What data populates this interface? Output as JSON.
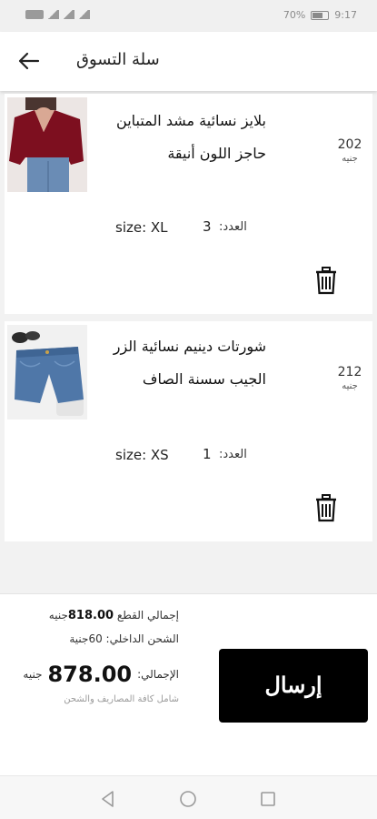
{
  "status_bar": {
    "battery": "70%",
    "battery_level": 0.7,
    "time": "9:17"
  },
  "header": {
    "title": "سلة التسوق"
  },
  "cart_items": [
    {
      "name": "بلايز نسائية مشد المتباين حاجز اللون أنيقة",
      "price": "202",
      "currency": "جنيه",
      "size": "size: XL",
      "qty_label": "العدد:",
      "qty": "3"
    },
    {
      "name": "شورتات دينيم نسائية الزر الجيب سسنة الصاف",
      "price": "212",
      "currency": "جنيه",
      "size": "size: XS",
      "qty_label": "العدد:",
      "qty": "1"
    }
  ],
  "summary": {
    "items_total_label": "إجمالي القطع",
    "items_total_value": "818.00",
    "items_total_currency": "جنيه",
    "shipping_text": "الشحن الداخلي: 60جنية",
    "total_label": "الإجمالي:",
    "total_value": "878.00",
    "total_currency": "جنيه",
    "note": "شامل كافة المصاريف والشحن"
  },
  "send_button": {
    "label": "إرسال",
    "background": "#000000"
  }
}
